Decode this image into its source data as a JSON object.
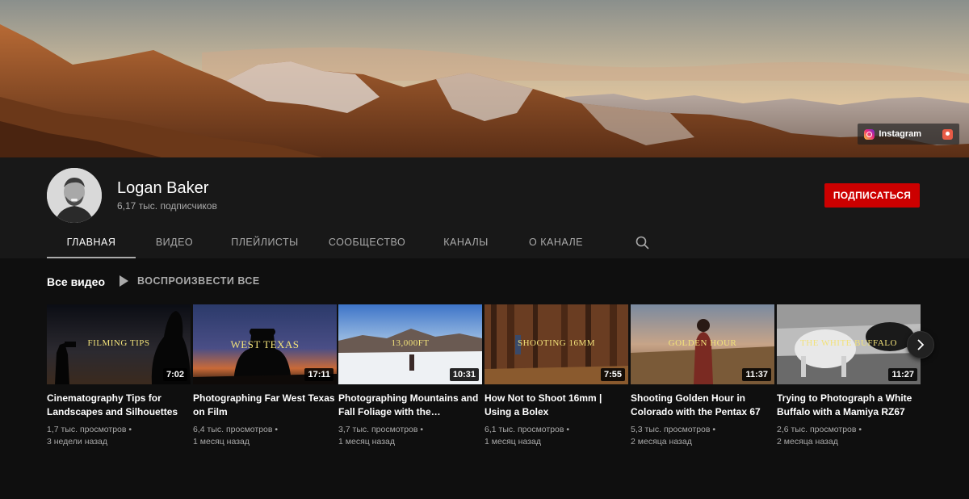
{
  "banner": {
    "links": [
      {
        "label": "Instagram",
        "icon": "instagram-icon"
      },
      {
        "label": "",
        "icon": "patreon-icon"
      }
    ]
  },
  "channel": {
    "name": "Logan Baker",
    "subscribers": "6,17 тыс. подписчиков",
    "subscribe_label": "ПОДПИСАТЬСЯ",
    "subscribe_color": "#cc0000"
  },
  "tabs": [
    {
      "label": "ГЛАВНАЯ",
      "active": true
    },
    {
      "label": "ВИДЕО",
      "active": false
    },
    {
      "label": "ПЛЕЙЛИСТЫ",
      "active": false
    },
    {
      "label": "СООБЩЕСТВО",
      "active": false
    },
    {
      "label": "КАНАЛЫ",
      "active": false
    },
    {
      "label": "О КАНАЛЕ",
      "active": false
    }
  ],
  "section": {
    "title": "Все видео",
    "play_all": "ВОСПРОИЗВЕСТИ ВСЕ"
  },
  "videos": [
    {
      "title": "Cinematography Tips for Landscapes and Silhouettes",
      "views": "1,7 тыс. просмотров",
      "age": "3 недели назад",
      "duration": "7:02",
      "thumb_text": "FILMING TIPS"
    },
    {
      "title": "Photographing Far West Texas on Film",
      "views": "6,4 тыс. просмотров",
      "age": "1 месяц назад",
      "duration": "17:11",
      "thumb_text": "WEST TEXAS"
    },
    {
      "title": "Photographing Mountains and Fall Foliage with the…",
      "views": "3,7 тыс. просмотров",
      "age": "1 месяц назад",
      "duration": "10:31",
      "thumb_text": "13,000FT"
    },
    {
      "title": "How Not to Shoot 16mm | Using a Bolex",
      "views": "6,1 тыс. просмотров",
      "age": "1 месяц назад",
      "duration": "7:55",
      "thumb_text": "SHOOTING 16MM"
    },
    {
      "title": "Shooting Golden Hour in Colorado with the Pentax 67",
      "views": "5,3 тыс. просмотров",
      "age": "2 месяца назад",
      "duration": "11:37",
      "thumb_text": "GOLDEN HOUR"
    },
    {
      "title": "Trying to Photograph a White Buffalo with a Mamiya RZ67",
      "views": "2,6 тыс. просмотров",
      "age": "2 месяца назад",
      "duration": "11:27",
      "thumb_text": "THE WHITE BUFFALO"
    }
  ],
  "meta_separator": "•"
}
